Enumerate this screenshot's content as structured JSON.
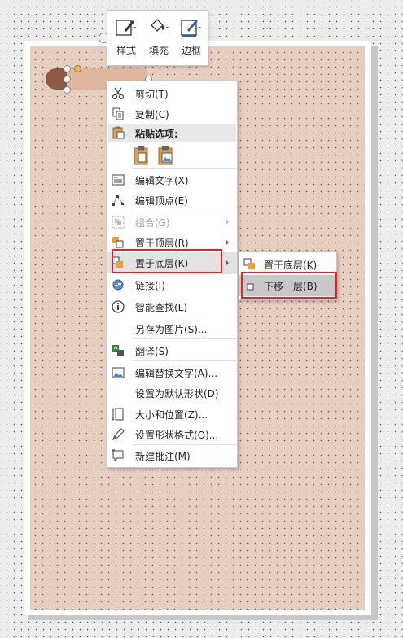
{
  "mini_toolbar": {
    "style_label": "样式",
    "fill_label": "填充",
    "border_label": "边框"
  },
  "context_menu": {
    "items": [
      {
        "label": "剪切(T)",
        "icon": "scissors-icon"
      },
      {
        "label": "复制(C)",
        "icon": "copy-icon"
      },
      {
        "label": "粘贴选项:",
        "icon": "paste-icon"
      },
      {
        "label": "编辑文字(X)",
        "icon": "edit-text-icon"
      },
      {
        "label": "编辑顶点(E)",
        "icon": "edit-points-icon"
      },
      {
        "label": "组合(G)",
        "icon": "group-icon",
        "disabled": true
      },
      {
        "label": "置于顶层(R)",
        "icon": "bring-to-front-icon"
      },
      {
        "label": "置于底层(K)",
        "icon": "send-to-back-icon"
      },
      {
        "label": "链接(I)",
        "icon": "link-icon"
      },
      {
        "label": "智能查找(L)",
        "icon": "smart-lookup-icon"
      },
      {
        "label": "另存为图片(S)...",
        "icon": ""
      },
      {
        "label": "翻译(S)",
        "icon": "translate-icon"
      },
      {
        "label": "编辑替换文字(A)...",
        "icon": "alt-text-icon"
      },
      {
        "label": "设置为默认形状(D)",
        "icon": ""
      },
      {
        "label": "大小和位置(Z)...",
        "icon": "size-position-icon"
      },
      {
        "label": "设置形状格式(O)...",
        "icon": "format-shape-icon"
      },
      {
        "label": "新建批注(M)",
        "icon": "new-comment-icon"
      }
    ]
  },
  "submenu": {
    "items": [
      {
        "label": "置于底层(K)",
        "icon": "send-to-back-icon"
      },
      {
        "label": "下移一层(B)",
        "icon": "send-backward-icon"
      }
    ]
  },
  "colors": {
    "slide_fill": "#e5cdbf",
    "highlight_box": "#e8202a",
    "shape_dark": "#8c5a43",
    "shape_light": "#e0b79d"
  }
}
